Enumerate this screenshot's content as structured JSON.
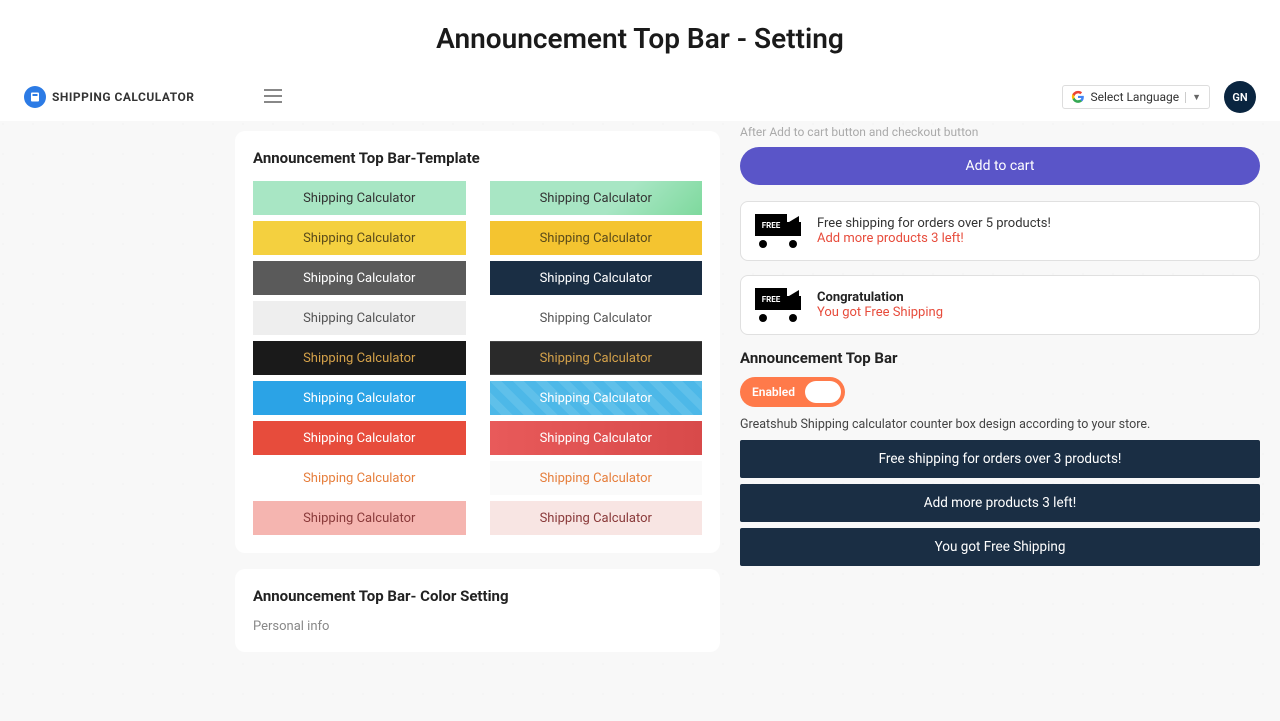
{
  "page_title": "Announcement Top Bar - Setting",
  "brand": "SHIPPING CALCULATOR",
  "lang": "Select Language",
  "avatar": "GN",
  "left": {
    "card1_title": "Announcement Top Bar-Template",
    "tpl_label": "Shipping Calculator",
    "card2_title": "Announcement Top Bar- Color Setting",
    "card2_sub": "Personal info"
  },
  "right": {
    "truncated_line": "After Add to cart button and checkout button",
    "add_to_cart": "Add to cart",
    "truck_label": "FREE",
    "box1_line1": "Free shipping for orders over 5 products!",
    "box1_line2": "Add more products 3 left!",
    "box2_line1": "Congratulation",
    "box2_line2": "You got Free Shipping",
    "section_title": "Announcement Top Bar",
    "toggle_label": "Enabled",
    "desc": "Greatshub Shipping calculator counter box design according to your store.",
    "bar1": "Free shipping for orders over 3 products!",
    "bar2": "Add more products 3 left!",
    "bar3": "You got Free Shipping"
  }
}
